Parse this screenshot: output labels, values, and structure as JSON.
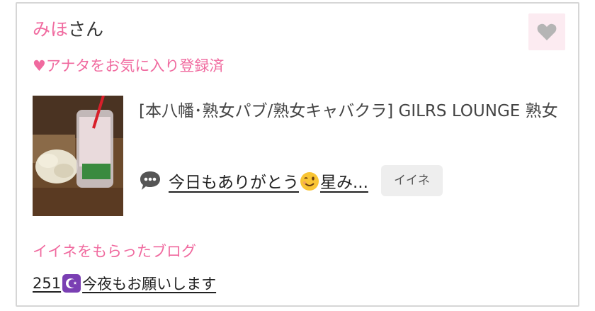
{
  "user": {
    "name": "みほ",
    "suffix": "さん"
  },
  "favorite_status": "♥アナタをお気に入り登録済",
  "shop": {
    "category": "[本八幡･熟女パブ/熟女キャバクラ]  GILRS LOUNGE 熟女"
  },
  "latest_blog": {
    "title_part1": "今日もありがとう",
    "title_part2": "星み...",
    "like_button": "イイネ"
  },
  "received_likes": {
    "heading": "イイネをもらったブログ",
    "count": "251",
    "title": "今夜もお願いします"
  },
  "icons": {
    "favorite": "heart-icon",
    "comment": "speech-bubble-icon",
    "emoji": "winking-face-icon",
    "moon": "star-and-crescent-icon"
  },
  "colors": {
    "accent": "#f06a9f",
    "heart_bg": "#fcebf1",
    "heart_icon": "#b5b5b5",
    "moon_badge": "#7a3fb3"
  }
}
